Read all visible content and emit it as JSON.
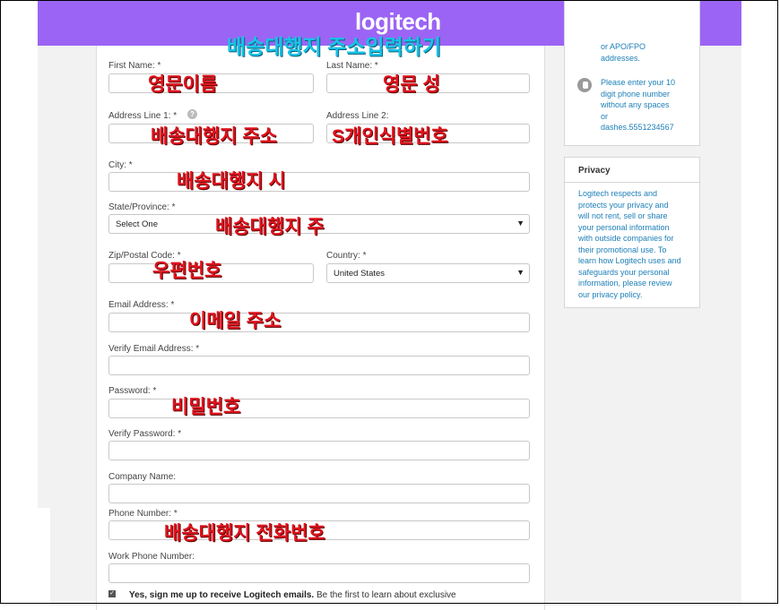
{
  "brand": {
    "logo": "logitech",
    "color": "#9b64f5"
  },
  "overlay_title": "배송대행지 주소입력하기",
  "form": {
    "first_name": {
      "label": "First Name: *",
      "annotation": "영문이름"
    },
    "last_name": {
      "label": "Last Name: *",
      "annotation": "영문 성"
    },
    "address1": {
      "label": "Address Line 1: *",
      "annotation": "배송대행지 주소"
    },
    "address2": {
      "label": "Address Line 2:",
      "annotation": "S개인식별번호"
    },
    "city": {
      "label": "City: *",
      "annotation": "배송대행지 시"
    },
    "state": {
      "label": "State/Province: *",
      "value": "Select One",
      "annotation": "배송대행지 주"
    },
    "zip": {
      "label": "Zip/Postal Code: *",
      "annotation": "우편번호"
    },
    "country": {
      "label": "Country: *",
      "value": "United States"
    },
    "email": {
      "label": "Email Address: *",
      "annotation": "이메일 주소"
    },
    "verify_email": {
      "label": "Verify Email Address: *"
    },
    "password": {
      "label": "Password: *",
      "annotation": "비밀번호"
    },
    "verify_password": {
      "label": "Verify Password: *"
    },
    "company": {
      "label": "Company Name:"
    },
    "phone": {
      "label": "Phone Number: *",
      "annotation": "배송대행지 전화번호"
    },
    "work_phone": {
      "label": "Work Phone Number:"
    },
    "newsletter": {
      "bold": "Yes, sign me up to receive Logitech emails.",
      "rest": " Be the first to learn about exclusive",
      "checked": true
    }
  },
  "sidebar": {
    "tip_top_lines": [
      "or APO/FPO",
      "addresses."
    ],
    "phone_tip_lines": [
      "Please enter your 10",
      "digit phone number",
      "without any spaces",
      "or",
      "dashes.5551234567"
    ],
    "privacy_title": "Privacy",
    "privacy_lines": [
      "Logitech respects and",
      "protects your privacy and",
      "will not rent, sell or share",
      "your personal information",
      "with outside companies for",
      "their promotional use. To",
      "learn how Logitech uses and",
      "safeguards your personal",
      "information, please review",
      "our privacy policy."
    ]
  }
}
